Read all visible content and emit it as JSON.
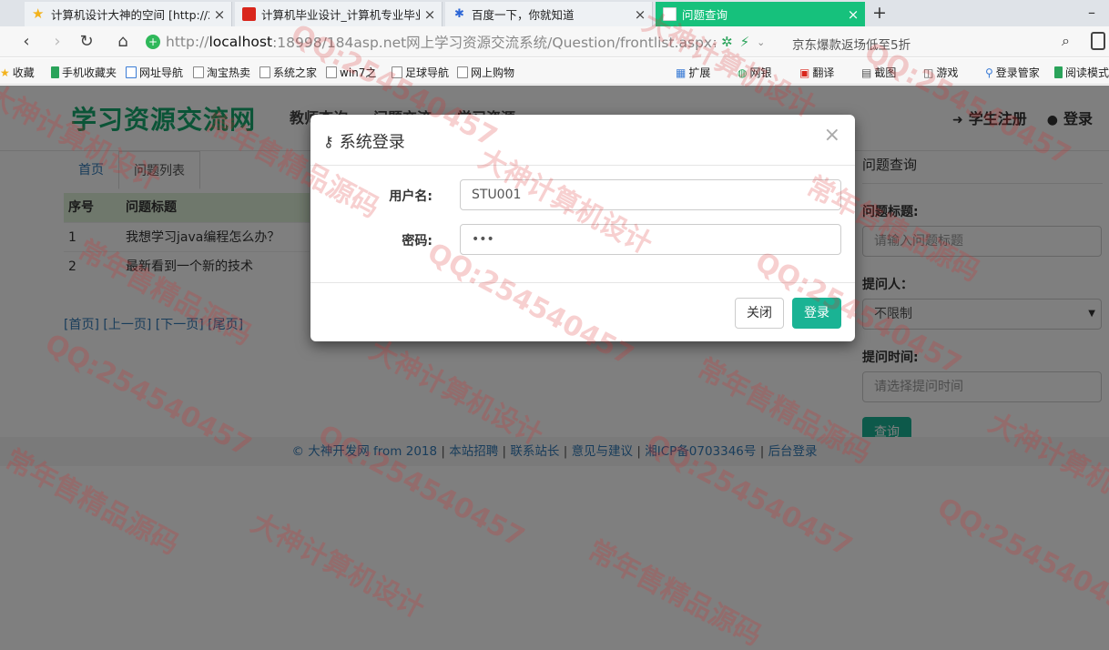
{
  "browser": {
    "tabs": [
      {
        "title": "计算机设计大神的空间 [http://2",
        "icon": "star-icon",
        "active": false
      },
      {
        "title": "计算机毕业设计_计算机专业毕业",
        "icon": "red-square-icon",
        "active": false
      },
      {
        "title": "百度一下，你就知道",
        "icon": "paw-icon",
        "active": false
      },
      {
        "title": "问题查询",
        "icon": "page-icon",
        "active": true
      }
    ],
    "url_prefix": "http://",
    "url_host": "localhost",
    "url_rest": ":18998/184asp.net网上学习资源交流系统/Question/frontlist.aspx#",
    "promo": "京东爆款返场低至5折",
    "bookmarks": [
      "收藏",
      "手机收藏夹",
      "网址导航",
      "淘宝热卖",
      "系统之家",
      "win7之",
      "足球导航",
      "网上购物",
      "扩展",
      "网银",
      "翻译",
      "截图",
      "游戏",
      "登录管家",
      "阅读模式"
    ]
  },
  "site": {
    "logo": "学习资源交流网",
    "nav": [
      "教师查询",
      "问题交流",
      "学习资源"
    ],
    "register": "学生注册",
    "login": "登录"
  },
  "crumbs": [
    "首页",
    "问题列表"
  ],
  "table": {
    "headers": [
      "序号",
      "问题标题"
    ],
    "rows": [
      [
        "1",
        "我想学习java编程怎么办？"
      ],
      [
        "2",
        "最新看到一个新的技术"
      ]
    ]
  },
  "pager": [
    "[首页]",
    "[上一页]",
    "[下一页]",
    "[尾页]"
  ],
  "sidebar": {
    "title": "问题查询",
    "title_label": "问题标题:",
    "title_placeholder": "请输入问题标题",
    "asker_label": "提问人：",
    "asker_value": "不限制",
    "time_label": "提问时间:",
    "time_placeholder": "请选择提问时间",
    "search_btn": "查询"
  },
  "footer": {
    "copyright": "© 大神开发网 from 2018",
    "links": [
      "本站招聘",
      "联系站长",
      "意见与建议",
      "湘ICP备0703346号",
      "后台登录"
    ]
  },
  "modal": {
    "title": "系统登录",
    "username_label": "用户名:",
    "username_value": "STU001",
    "password_label": "密码:",
    "password_value": "•••",
    "close_btn": "关闭",
    "login_btn": "登录"
  },
  "watermarks": [
    "大神计算机设计",
    "QQ:254540457",
    "常年售精品源码"
  ],
  "colors": {
    "accent": "#1ab394",
    "logo": "#17a96e",
    "active_tab": "#16c17c",
    "link": "#337ab7"
  }
}
